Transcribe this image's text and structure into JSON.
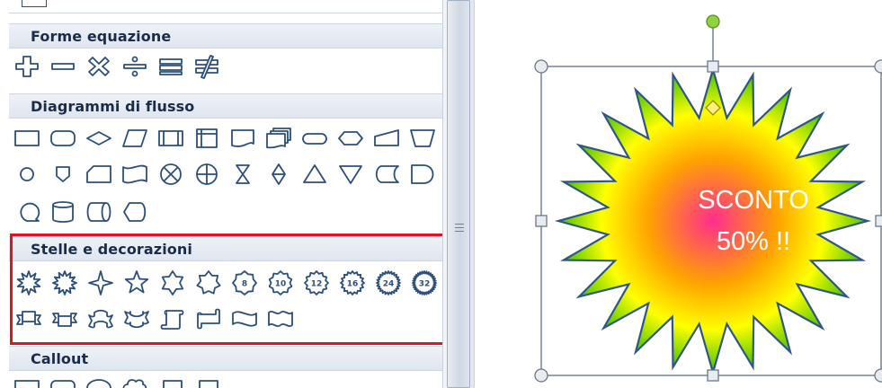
{
  "panel": {
    "sections": [
      {
        "title": "Forme equazione"
      },
      {
        "title": "Diagrammi di flusso"
      },
      {
        "title": "Stelle e decorazioni"
      },
      {
        "title": "Callout"
      }
    ],
    "highlighted_section": "Stelle e decorazioni",
    "highlight_color": "#e0141e"
  },
  "canvas": {
    "shape": {
      "type": "24-point star",
      "text_line1": "SCONTO",
      "text_line2": "50% !!",
      "gradient": [
        "#ff2d8f",
        "#ffa300",
        "#ffff00",
        "#43c000"
      ],
      "outline_color": "#2f5688"
    },
    "star_badges": [
      "8",
      "10",
      "12",
      "16",
      "24",
      "32"
    ]
  }
}
